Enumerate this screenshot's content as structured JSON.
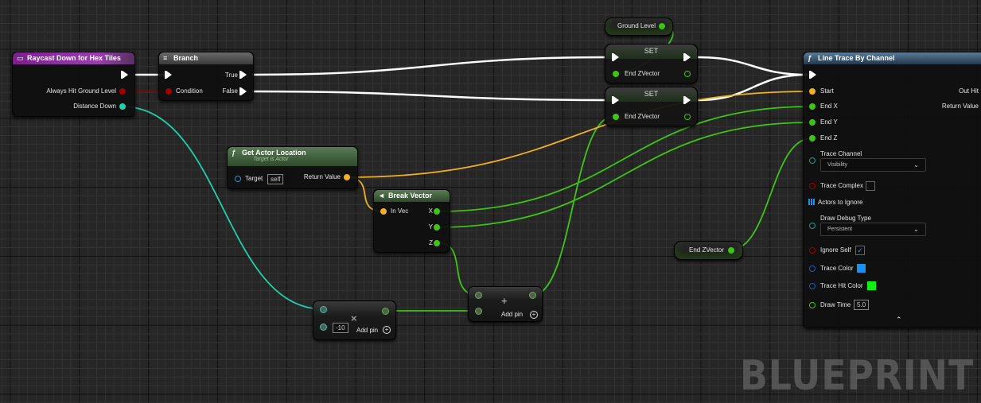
{
  "canvas": {
    "watermark": "BLUEPRINT",
    "colors": {
      "background": "#262626",
      "exec_wire": "#ffffff",
      "float_wire": "#3ec413",
      "vector_wire": "#f0b020",
      "bool_wire": "#8c0000",
      "int_wire": "#1fd0a8"
    }
  },
  "nodes": {
    "event": {
      "title": "Raycast Down for Hex Tiles",
      "title_icon": "event-icon",
      "color": "#7a1f8c",
      "outputs": [
        "Always Hit Ground Level",
        "Distance Down"
      ]
    },
    "branch": {
      "title": "Branch",
      "title_icon": "branch-icon",
      "input": "Condition",
      "outputs": [
        "True",
        "False"
      ]
    },
    "get_actor_location": {
      "title": "Get Actor Location",
      "subtitle": "Target is Actor",
      "title_icon": "function-icon",
      "input_label": "Target",
      "input_value": "self",
      "output": "Return Value"
    },
    "break_vector": {
      "title": "Break Vector",
      "title_icon": "break-struct-icon",
      "input": "In Vec",
      "outputs": [
        "X",
        "Y",
        "Z"
      ]
    },
    "multiply": {
      "operator": "×",
      "value": "-10",
      "add_pin": "Add pin"
    },
    "add": {
      "operator": "+",
      "add_pin": "Add pin"
    },
    "ground_level": {
      "label": "Ground Level"
    },
    "set_1": {
      "title": "SET",
      "input": "End ZVector"
    },
    "set_2": {
      "title": "SET",
      "input": "End ZVector"
    },
    "end_zvector_get": {
      "label": "End ZVector"
    },
    "line_trace": {
      "title": "Line Trace By Channel",
      "title_icon": "function-icon",
      "inputs": [
        "Start",
        "End X",
        "End Y",
        "End Z"
      ],
      "outputs": [
        "Out Hit",
        "Return Value"
      ],
      "trace_channel_label": "Trace Channel",
      "trace_channel_value": "Visibility",
      "trace_complex_label": "Trace Complex",
      "trace_complex_checked": false,
      "actors_to_ignore_label": "Actors to Ignore",
      "draw_debug_type_label": "Draw Debug Type",
      "draw_debug_type_value": "Persistent",
      "ignore_self_label": "Ignore Self",
      "ignore_self_checked": true,
      "trace_color_label": "Trace Color",
      "trace_color": "#1a90f0",
      "trace_hit_color_label": "Trace Hit Color",
      "trace_hit_color": "#10f010",
      "draw_time_label": "Draw Time",
      "draw_time_value": "5.0",
      "collapse_icon": "chevron-up-icon"
    }
  }
}
